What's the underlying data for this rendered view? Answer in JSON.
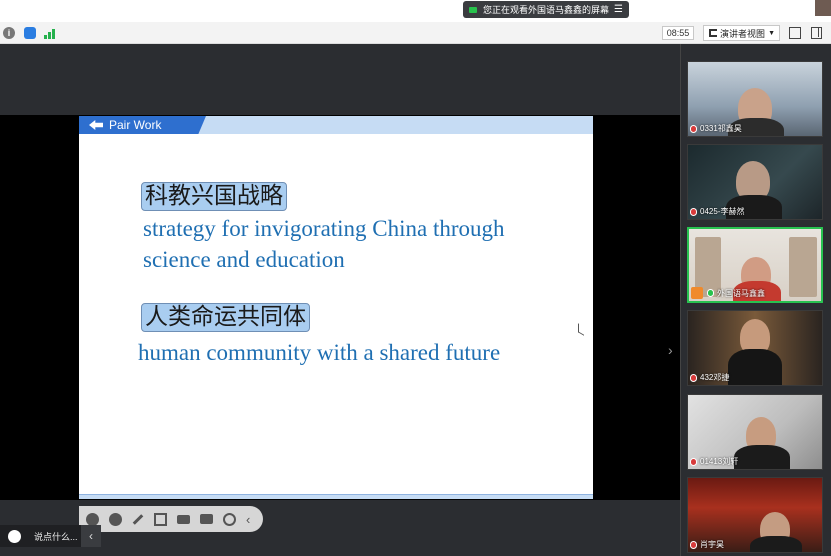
{
  "topbar": {
    "share_notice": "您正在观看外国语马鑫鑫的屏幕",
    "menu_glyph": "☰"
  },
  "toolbar": {
    "info_glyph": "i",
    "timer": "08:55",
    "view_label": "演讲者视图"
  },
  "slide": {
    "header_label": "Pair Work",
    "items": [
      {
        "cn": "科教兴国战略",
        "en_line1": "strategy for invigorating China through",
        "en_line2": "science and education"
      },
      {
        "cn": "人类命运共同体",
        "en_line1": "human community with a shared future"
      }
    ]
  },
  "chat": {
    "placeholder": "说点什么...",
    "collapse_glyph": "‹"
  },
  "stage_chevron": "›",
  "sidebar": {
    "up_glyph": "︿",
    "participants": [
      {
        "name": "0331祁鑫昊",
        "mic": "muted"
      },
      {
        "name": "0425-李赫然",
        "mic": "muted"
      },
      {
        "name": "外国语马鑫鑫",
        "mic": "active",
        "host": true
      },
      {
        "name": "432邓捷",
        "mic": "muted"
      },
      {
        "name": "01413刘轩",
        "mic": "muted"
      },
      {
        "name": "肖宇昊",
        "mic": "muted"
      }
    ]
  }
}
